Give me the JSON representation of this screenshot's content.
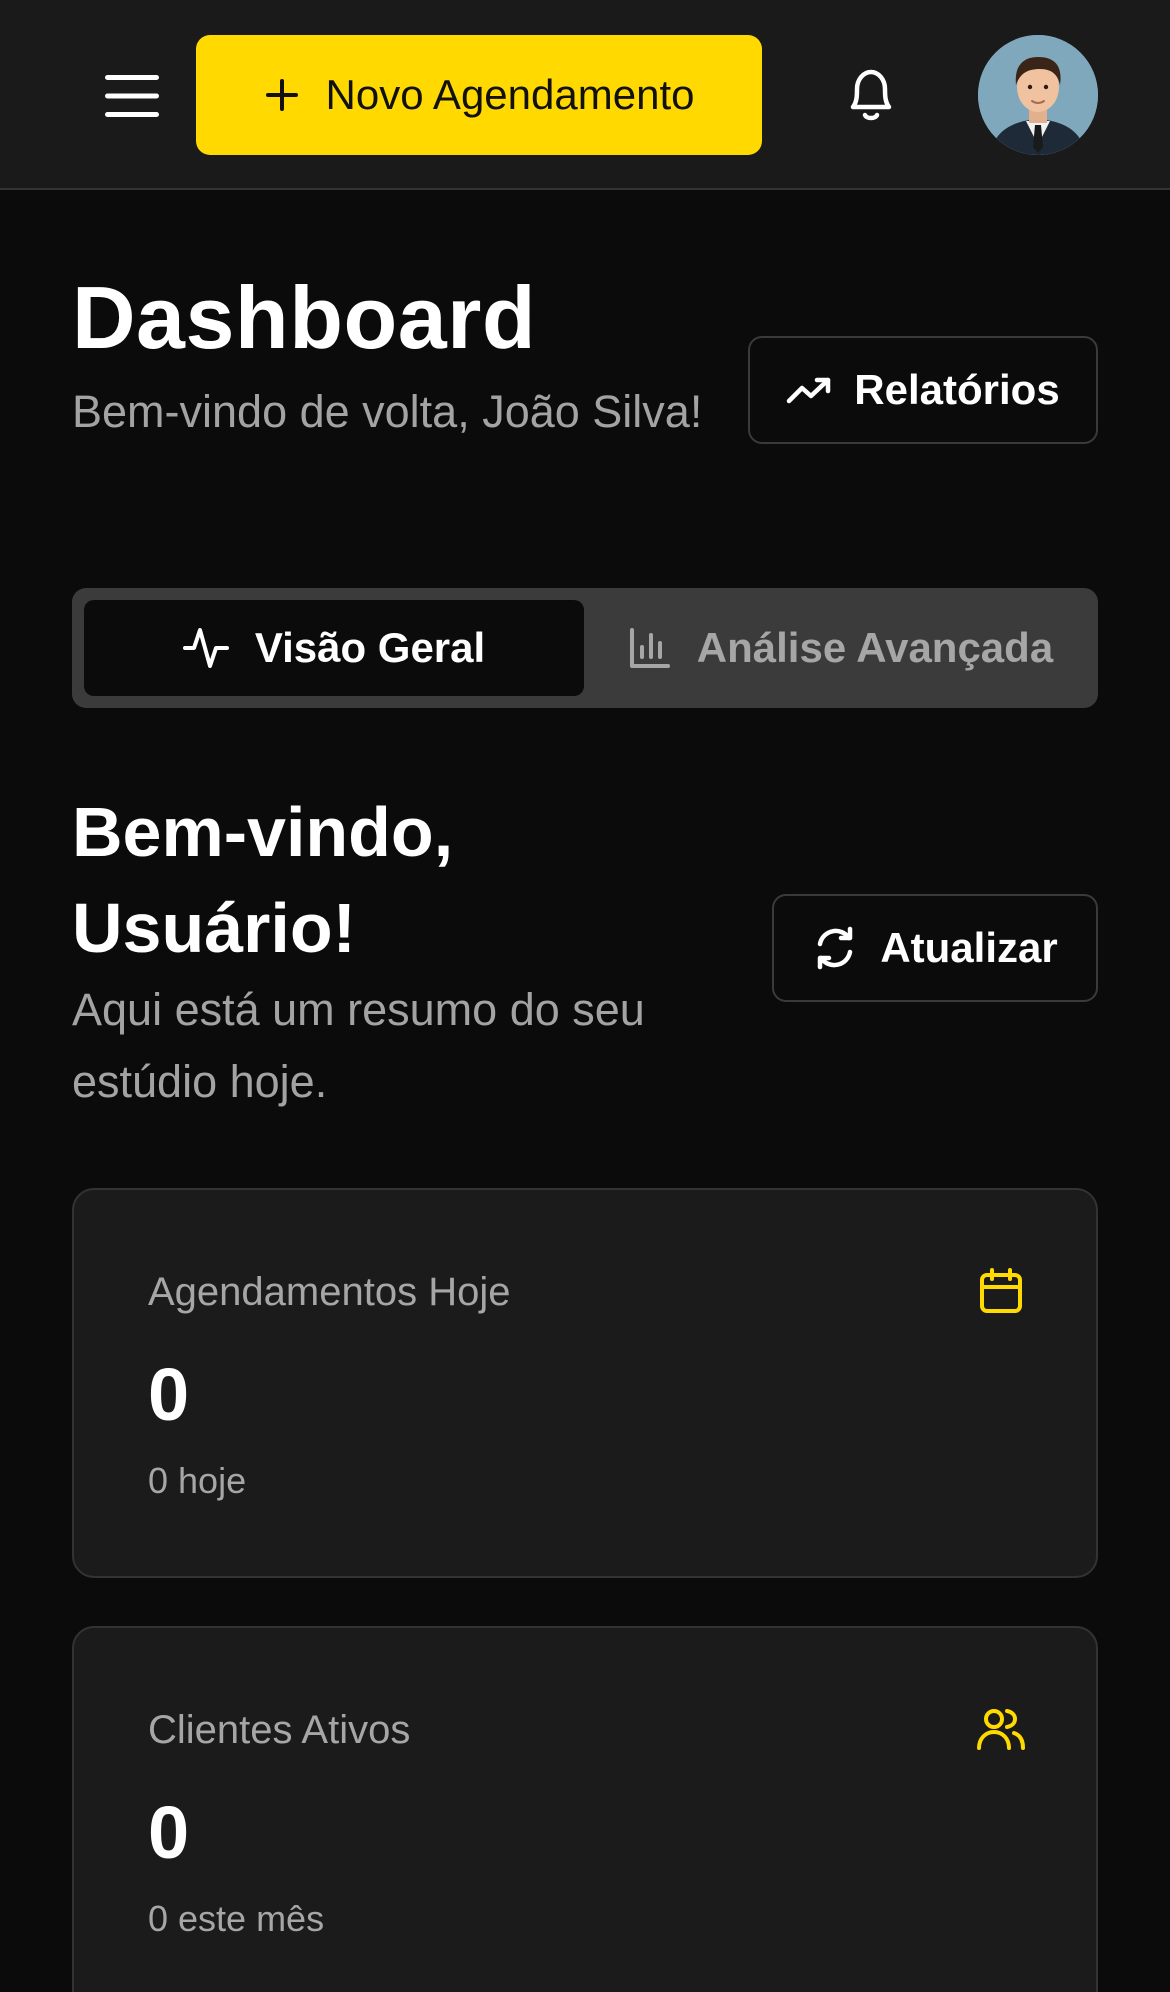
{
  "header": {
    "new_appointment_label": "Novo Agendamento"
  },
  "page": {
    "title": "Dashboard",
    "welcome_message": "Bem-vindo de volta, João Silva!",
    "reports_label": "Relatórios"
  },
  "tabs": [
    {
      "label": "Visão Geral",
      "active": true
    },
    {
      "label": "Análise Avançada",
      "active": false
    }
  ],
  "welcome": {
    "title": "Bem-vindo, Usuário!",
    "subtitle": "Aqui está um resumo do seu estúdio hoje.",
    "refresh_label": "Atualizar"
  },
  "stats": [
    {
      "label": "Agendamentos Hoje",
      "value": "0",
      "caption": "0 hoje",
      "icon": "calendar-icon"
    },
    {
      "label": "Clientes Ativos",
      "value": "0",
      "caption": "0 este mês",
      "icon": "users-icon"
    }
  ],
  "colors": {
    "accent": "#ffd900",
    "background": "#0b0b0b",
    "surface": "#1b1b1b",
    "muted_text": "#a3a3a3"
  }
}
